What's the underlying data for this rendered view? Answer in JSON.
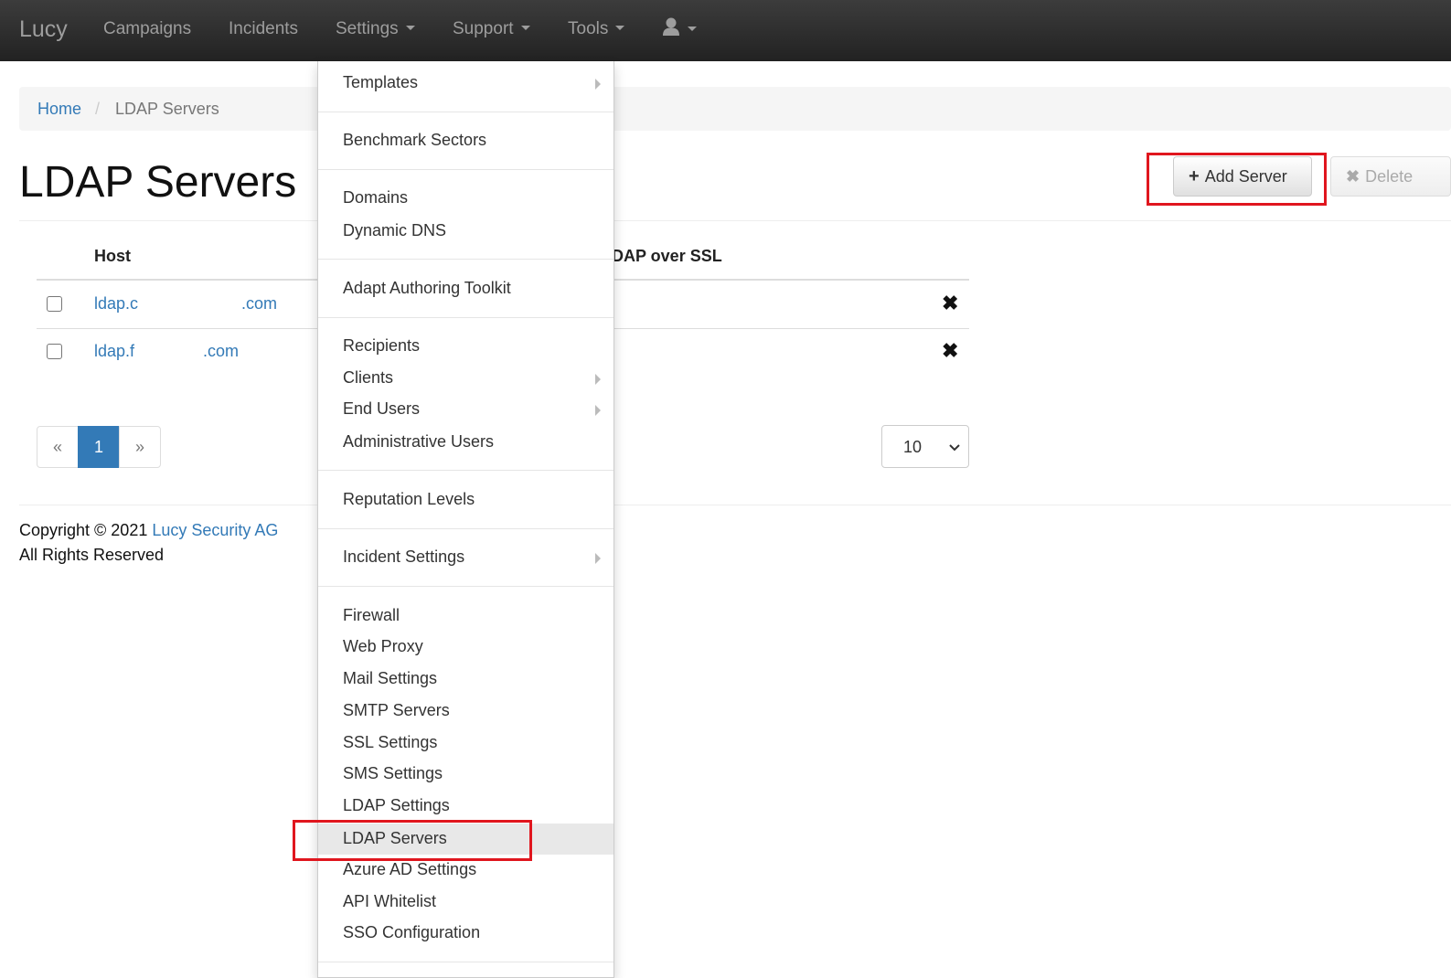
{
  "navbar": {
    "brand": "Lucy",
    "items": [
      "Campaigns",
      "Incidents",
      "Settings",
      "Support",
      "Tools"
    ],
    "user_icon": "user-icon"
  },
  "breadcrumb": {
    "home": "Home",
    "separator": "/",
    "current": "LDAP Servers"
  },
  "page": {
    "title": "LDAP Servers"
  },
  "buttons": {
    "add_server": "Add Server",
    "delete": "Delete",
    "plus_icon": "+",
    "x_icon": "✖"
  },
  "table": {
    "headers": {
      "host": "Host",
      "ssl": "DAP over SSL"
    },
    "rows": [
      {
        "host_start": "ldap.c",
        "host_end": ".com",
        "ssl": "✖"
      },
      {
        "host_start": "ldap.f",
        "host_end": ".com",
        "ssl": "✖"
      }
    ]
  },
  "pagination": {
    "prev": "«",
    "page": "1",
    "next": "»",
    "page_size": "10"
  },
  "footer": {
    "copyright_prefix": "Copyright © 2021",
    "company": "Lucy Security AG",
    "rights": "All Rights Reserved"
  },
  "dropdown": {
    "items": [
      "Templates",
      "Benchmark Sectors",
      "Domains",
      "Dynamic DNS",
      "Adapt Authoring Toolkit",
      "Recipients",
      "Clients",
      "End Users",
      "Administrative Users",
      "Reputation Levels",
      "Incident Settings",
      "Firewall",
      "Web Proxy",
      "Mail Settings",
      "SMTP Servers",
      "SSL Settings",
      "SMS Settings",
      "LDAP Settings",
      "LDAP Servers",
      "Azure AD Settings",
      "API Whitelist",
      "SSO Configuration"
    ]
  },
  "colors": {
    "link": "#337ab7",
    "highlight": "#e0161e",
    "navbar": "#222222"
  }
}
